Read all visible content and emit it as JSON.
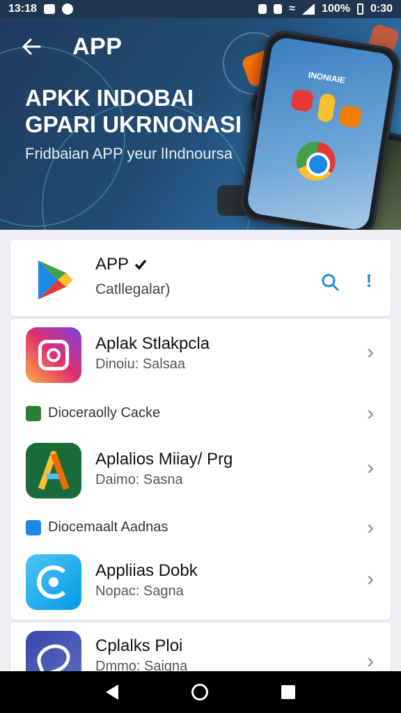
{
  "status_bar": {
    "time": "13:18",
    "battery": "100%",
    "clock_right": "0:30"
  },
  "hero": {
    "brand": "APP",
    "title": "APKK INDOBAI GPARI UKRNONASI",
    "subtitle": "Fridbaian APP yeur lIndnoursa",
    "phone_label": "INONIAIE"
  },
  "header": {
    "title": "APP",
    "subtitle": "Catllegalar)"
  },
  "apps": [
    {
      "name": "Aplak Stlakpcla",
      "meta": "Dinoiu: Salsaa",
      "colors": [
        "#7b3fe4",
        "#e1306c",
        "#fcaf45"
      ]
    },
    {
      "name": "Aplalios Miiay/ Prg",
      "meta": "Daimo: Sasna",
      "colors": [
        "#1b6b3a",
        "#2e8b4e"
      ]
    },
    {
      "name": "Appliias Dobk",
      "meta": "Nopac: Sagna",
      "colors": [
        "#29b6f6",
        "#039be5"
      ]
    },
    {
      "name": "Cplalks Ploi",
      "meta": "Dmmo: Saigna",
      "colors": [
        "#3949ab",
        "#5c6bc0"
      ]
    }
  ],
  "sections": [
    {
      "label": "Dioceraolly Cacke",
      "icon": "qr-icon",
      "color": "#2e7d32"
    },
    {
      "label": "Diocemaalt Aadnas",
      "icon": "photo-icon",
      "color": "#1e88e5"
    }
  ],
  "icons": {
    "back": "arrow-left-icon",
    "search": "search-icon",
    "more": "exclamation-icon",
    "play": "play-store-icon",
    "chevron": "chevron-right-icon"
  },
  "colors": {
    "accent": "#1e88e5",
    "hero_start": "#1e3c5e",
    "hero_end": "#3e86c0"
  }
}
